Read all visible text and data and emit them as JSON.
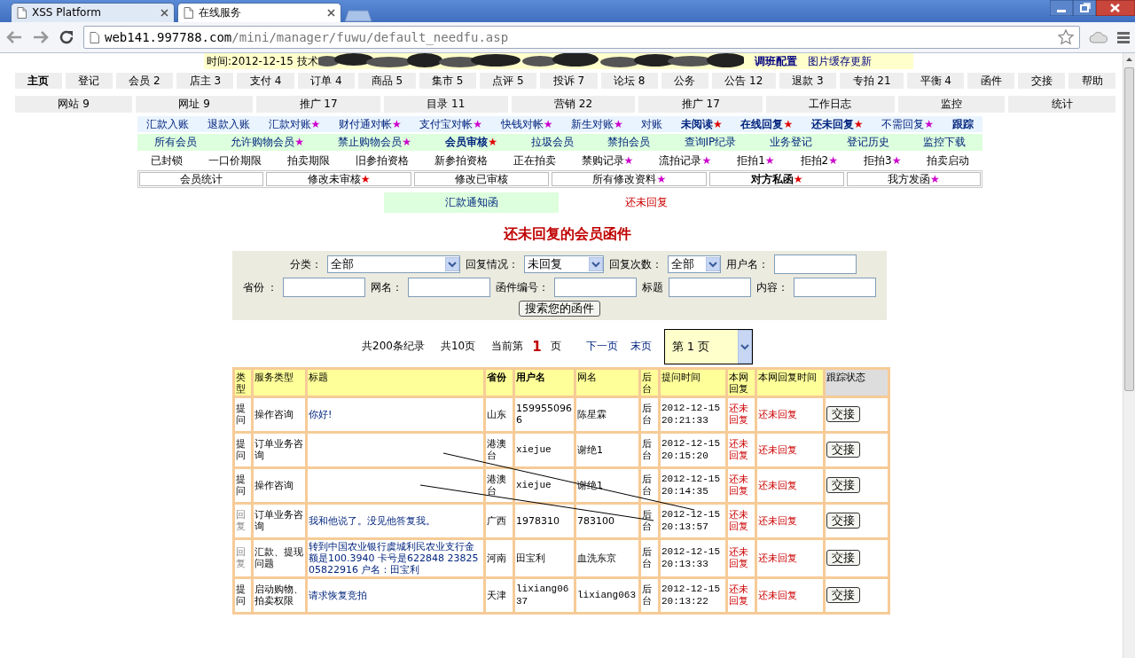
{
  "browser": {
    "tabs": [
      {
        "label": "XSS Platform",
        "selected": false
      },
      {
        "label": "在线服务",
        "selected": true
      }
    ],
    "url_host": "web141.997788.com",
    "url_path": "/mini/manager/fuwu/default_needfu.asp"
  },
  "notice": {
    "prefix": "时间:2012-12-15 技术",
    "links": [
      {
        "label": "调班配置",
        "bold": true
      },
      {
        "label": "图片缓存更新",
        "bold": false
      }
    ]
  },
  "nav_main": [
    {
      "label": "主页",
      "selected": true
    },
    {
      "label": "登记",
      "selected": false
    },
    {
      "label": "会员 2",
      "selected": false
    },
    {
      "label": "店主 3",
      "selected": false
    },
    {
      "label": "支付 4",
      "selected": false
    },
    {
      "label": "订单 4",
      "selected": false
    },
    {
      "label": "商品 5",
      "selected": false
    },
    {
      "label": "集市 5",
      "selected": false
    },
    {
      "label": "点评 5",
      "selected": false
    },
    {
      "label": "投诉 7",
      "selected": false
    },
    {
      "label": "论坛 8",
      "selected": false
    },
    {
      "label": "公务",
      "selected": false
    },
    {
      "label": "公告 12",
      "selected": false
    },
    {
      "label": "退款 3",
      "selected": false
    },
    {
      "label": "专拍 21",
      "selected": false
    },
    {
      "label": "平衡 4",
      "selected": false
    },
    {
      "label": "函件",
      "selected": false
    },
    {
      "label": "交接",
      "selected": false
    },
    {
      "label": "帮助",
      "selected": false
    }
  ],
  "nav_second": [
    "网站 9",
    "网址 9",
    "推广 17",
    "目录 11",
    "营销 22",
    "推广 17",
    "工作日志",
    "监控",
    "统计"
  ],
  "menu_rows": [
    {
      "kind": "blue",
      "items": [
        {
          "label": "汇款入账",
          "bold": false
        },
        {
          "label": "退款入账",
          "bold": false
        },
        {
          "label": "汇款对账",
          "bold": false,
          "star": {
            "text": "★",
            "color": "#cc00cc"
          }
        },
        {
          "label": "财付通对帐",
          "bold": false,
          "star": {
            "text": "★",
            "color": "#cc00cc"
          }
        },
        {
          "label": "支付宝对帐",
          "bold": false,
          "star": {
            "text": "★",
            "color": "#cc00cc"
          }
        },
        {
          "label": "快钱对帐",
          "bold": false,
          "star": {
            "text": "★",
            "color": "#cc00cc"
          }
        },
        {
          "label": "新生对账",
          "bold": false,
          "star": {
            "text": "★",
            "color": "#cc00cc"
          }
        },
        {
          "label": "对账",
          "bold": false
        },
        {
          "label": "未阅读",
          "bold": true,
          "star": {
            "text": "★",
            "color": "#e00000"
          }
        },
        {
          "label": "在线回复",
          "bold": true,
          "star": {
            "text": "★",
            "color": "#e00000"
          }
        },
        {
          "label": "还未回复",
          "bold": true,
          "star": {
            "text": "★",
            "color": "#e00000"
          }
        },
        {
          "label": "不需回复",
          "bold": false,
          "star": {
            "text": "★",
            "color": "#cc00cc"
          }
        },
        {
          "label": "跟踪",
          "bold": true
        }
      ]
    },
    {
      "kind": "green",
      "items": [
        {
          "label": "所有会员",
          "bold": false
        },
        {
          "label": "允许购物会员",
          "bold": false,
          "star": {
            "text": "★",
            "color": "#cc00cc"
          }
        },
        {
          "label": "禁止购物会员",
          "bold": false,
          "star": {
            "text": "★",
            "color": "#cc00cc"
          }
        },
        {
          "label": "会员审核",
          "bold": true,
          "star": {
            "text": "★",
            "color": "#e00000"
          }
        },
        {
          "label": "拉圾会员",
          "bold": false
        },
        {
          "label": "禁拍会员",
          "bold": false
        },
        {
          "label": "查询IP纪录",
          "bold": false
        },
        {
          "label": "业务登记",
          "bold": false
        },
        {
          "label": "登记历史",
          "bold": false
        },
        {
          "label": "监控下载",
          "bold": false
        }
      ]
    },
    {
      "kind": "plain",
      "items": [
        {
          "label": "已封锁",
          "bold": false
        },
        {
          "label": "一口价期限",
          "bold": false
        },
        {
          "label": "拍卖期限",
          "bold": false
        },
        {
          "label": "旧参拍资格",
          "bold": false
        },
        {
          "label": "新参拍资格",
          "bold": false
        },
        {
          "label": "正在拍卖",
          "bold": false
        },
        {
          "label": "禁购记录",
          "bold": false,
          "star": {
            "text": "★",
            "color": "#cc00cc"
          }
        },
        {
          "label": "流拍记录",
          "bold": false,
          "star": {
            "text": "★",
            "color": "#cc00cc"
          }
        },
        {
          "label": "拒拍1",
          "bold": false,
          "star": {
            "text": "★",
            "color": "#cc00cc"
          }
        },
        {
          "label": "拒拍2",
          "bold": false,
          "star": {
            "text": "★",
            "color": "#cc00cc"
          }
        },
        {
          "label": "拒拍3",
          "bold": false,
          "star": {
            "text": "★",
            "color": "#cc00cc"
          }
        },
        {
          "label": "拍卖启动",
          "bold": false
        }
      ]
    },
    {
      "kind": "boxed",
      "items": [
        {
          "label": "会员统计",
          "bold": false
        },
        {
          "label": "修改未审核",
          "bold": false,
          "star": {
            "text": "★",
            "color": "#e00000"
          }
        },
        {
          "label": "修改已审核",
          "bold": false
        },
        {
          "label": "所有修改资料",
          "bold": false,
          "star": {
            "text": "★",
            "color": "#cc00cc"
          }
        },
        {
          "label": "对方私函",
          "bold": true,
          "star": {
            "text": "★",
            "color": "#e00000"
          }
        },
        {
          "label": "我方发函",
          "bold": false,
          "star": {
            "text": "★",
            "color": "#cc00cc"
          }
        }
      ]
    }
  ],
  "sub_tabs": [
    {
      "label": "汇款通知函",
      "selected": false
    },
    {
      "label": "还未回复",
      "selected": true
    }
  ],
  "heading": "还未回复的会员函件",
  "search_form": {
    "lines": [
      {
        "fields": [
          {
            "label": "分类：",
            "kind": "select",
            "value": "全部"
          },
          {
            "label": "回复情况：",
            "kind": "select",
            "value": "未回复"
          },
          {
            "label": "回复次数：",
            "kind": "select",
            "value": "全部"
          },
          {
            "label": "用户名：",
            "kind": "input"
          }
        ]
      },
      {
        "fields": [
          {
            "label": "省份 ：",
            "kind": "input"
          },
          {
            "label": "网名：",
            "kind": "input"
          },
          {
            "label": "函件编号：",
            "kind": "input"
          },
          {
            "label": "标题",
            "kind": "input"
          },
          {
            "label": "内容：",
            "kind": "input"
          }
        ]
      }
    ],
    "button": "搜索您的函件"
  },
  "pager": {
    "total": "共200条纪录",
    "pages": "共10页",
    "current_prefix": "当前第",
    "current": "1",
    "current_suffix": "页",
    "next": "下一页",
    "last": "末页",
    "page_select": "第 1 页"
  },
  "table": {
    "columns": [
      "类型",
      "服务类型",
      "标题",
      "省份",
      "用户名",
      "网名",
      "后台",
      "提问时间",
      "本网回复",
      "本网回复时间",
      "跟踪状态"
    ],
    "rows": [
      {
        "kind": "question",
        "type": "提问",
        "service": "操作咨询",
        "title": "你好!",
        "province": "山东",
        "username": "1599550966",
        "nickname": "陈星霖",
        "backend": "后台",
        "time": "2012-12-15 20:21:33",
        "reply": "还未回复",
        "reply_time": "还未回复",
        "action": "交接"
      },
      {
        "kind": "question",
        "type": "提问",
        "service": "订单业务咨询",
        "province": "港澳台",
        "username": "xiejue",
        "nickname": "谢绝1",
        "backend": "后台",
        "time": "2012-12-15 20:15:20",
        "reply": "还未回复",
        "reply_time": "还未回复",
        "action": "交接"
      },
      {
        "kind": "question",
        "type": "提问",
        "service": "操作咨询",
        "province": "港澳台",
        "username": "xiejue",
        "nickname": "谢绝1",
        "backend": "后台",
        "time": "2012-12-15 20:14:35",
        "reply": "还未回复",
        "reply_time": "还未回复",
        "action": "交接"
      },
      {
        "kind": "reply",
        "type": "回复",
        "service": "订单业务咨询",
        "title": "我和他说了。没见他答复我。",
        "province": "广西",
        "username": "1978310",
        "nickname": "783100",
        "backend": "后台",
        "time": "2012-12-15 20:13:57",
        "reply": "还未回复",
        "reply_time": "还未回复",
        "action": "交接"
      },
      {
        "kind": "reply",
        "type": "回复",
        "service": "汇款、提现问题",
        "title": "转到中国农业银行虞城利民农业支行金额是100.3940 卡号是622848 2382505822916 户名：田宝利",
        "province": "河南",
        "username": "田宝利",
        "nickname": "血洗东京",
        "backend": "后台",
        "time": "2012-12-15 20:13:33",
        "reply": "还未回复",
        "reply_time": "还未回复",
        "action": "交接"
      },
      {
        "kind": "question",
        "type": "提问",
        "service": "启动购物、拍卖权限",
        "title": "请求恢复竞拍",
        "province": "天津",
        "username": "lixiang0637",
        "nickname": "lixiang063",
        "backend": "后台",
        "time": "2012-12-15 20:13:22",
        "reply": "还未回复",
        "reply_time": "还未回复",
        "action": "交接"
      }
    ]
  }
}
